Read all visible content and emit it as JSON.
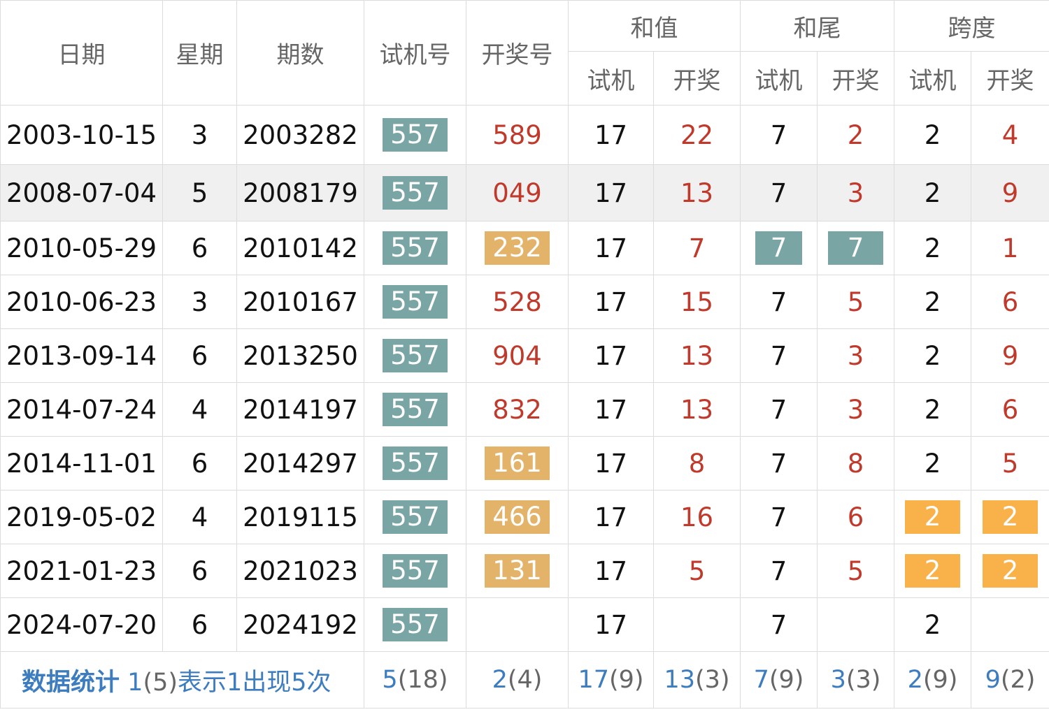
{
  "headers": {
    "date": "日期",
    "weekday": "星期",
    "issue": "期数",
    "trial": "试机号",
    "draw": "开奖号",
    "sum": "和值",
    "tail": "和尾",
    "span": "跨度",
    "sub_trial": "试机",
    "sub_draw": "开奖"
  },
  "rows": [
    {
      "date": "2003-10-15",
      "weekday": "3",
      "issue": "2003282",
      "trial": "557",
      "draw": "589",
      "draw_hl": false,
      "sum_trial": "17",
      "sum_draw": "22",
      "tail_trial": "7",
      "tail_draw": "2",
      "tail_hl": false,
      "span_trial": "2",
      "span_draw": "4",
      "span_hl": false
    },
    {
      "date": "2008-07-04",
      "weekday": "5",
      "issue": "2008179",
      "trial": "557",
      "draw": "049",
      "draw_hl": false,
      "sum_trial": "17",
      "sum_draw": "13",
      "tail_trial": "7",
      "tail_draw": "3",
      "tail_hl": false,
      "span_trial": "2",
      "span_draw": "9",
      "span_hl": false
    },
    {
      "date": "2010-05-29",
      "weekday": "6",
      "issue": "2010142",
      "trial": "557",
      "draw": "232",
      "draw_hl": true,
      "sum_trial": "17",
      "sum_draw": "7",
      "tail_trial": "7",
      "tail_draw": "7",
      "tail_hl": true,
      "span_trial": "2",
      "span_draw": "1",
      "span_hl": false
    },
    {
      "date": "2010-06-23",
      "weekday": "3",
      "issue": "2010167",
      "trial": "557",
      "draw": "528",
      "draw_hl": false,
      "sum_trial": "17",
      "sum_draw": "15",
      "tail_trial": "7",
      "tail_draw": "5",
      "tail_hl": false,
      "span_trial": "2",
      "span_draw": "6",
      "span_hl": false
    },
    {
      "date": "2013-09-14",
      "weekday": "6",
      "issue": "2013250",
      "trial": "557",
      "draw": "904",
      "draw_hl": false,
      "sum_trial": "17",
      "sum_draw": "13",
      "tail_trial": "7",
      "tail_draw": "3",
      "tail_hl": false,
      "span_trial": "2",
      "span_draw": "9",
      "span_hl": false
    },
    {
      "date": "2014-07-24",
      "weekday": "4",
      "issue": "2014197",
      "trial": "557",
      "draw": "832",
      "draw_hl": false,
      "sum_trial": "17",
      "sum_draw": "13",
      "tail_trial": "7",
      "tail_draw": "3",
      "tail_hl": false,
      "span_trial": "2",
      "span_draw": "6",
      "span_hl": false
    },
    {
      "date": "2014-11-01",
      "weekday": "6",
      "issue": "2014297",
      "trial": "557",
      "draw": "161",
      "draw_hl": true,
      "sum_trial": "17",
      "sum_draw": "8",
      "tail_trial": "7",
      "tail_draw": "8",
      "tail_hl": false,
      "span_trial": "2",
      "span_draw": "5",
      "span_hl": false
    },
    {
      "date": "2019-05-02",
      "weekday": "4",
      "issue": "2019115",
      "trial": "557",
      "draw": "466",
      "draw_hl": true,
      "sum_trial": "17",
      "sum_draw": "16",
      "tail_trial": "7",
      "tail_draw": "6",
      "tail_hl": false,
      "span_trial": "2",
      "span_draw": "2",
      "span_hl": true
    },
    {
      "date": "2021-01-23",
      "weekday": "6",
      "issue": "2021023",
      "trial": "557",
      "draw": "131",
      "draw_hl": true,
      "sum_trial": "17",
      "sum_draw": "5",
      "tail_trial": "7",
      "tail_draw": "5",
      "tail_hl": false,
      "span_trial": "2",
      "span_draw": "2",
      "span_hl": true
    },
    {
      "date": "2024-07-20",
      "weekday": "6",
      "issue": "2024192",
      "trial": "557",
      "draw": "",
      "draw_hl": false,
      "sum_trial": "17",
      "sum_draw": "",
      "tail_trial": "7",
      "tail_draw": "",
      "tail_hl": false,
      "span_trial": "2",
      "span_draw": "",
      "span_hl": false
    }
  ],
  "summary": {
    "title": "数据统计",
    "note_a": "1",
    "note_b": "(5)",
    "note_c": "表示1出现5次",
    "cells": [
      {
        "a": "5",
        "b": "(18)"
      },
      {
        "a": "2",
        "b": "(4)"
      },
      {
        "a": "17",
        "b": "(9)"
      },
      {
        "a": "13",
        "b": "(3)"
      },
      {
        "a": "7",
        "b": "(9)"
      },
      {
        "a": "3",
        "b": "(3)"
      },
      {
        "a": "2",
        "b": "(9)"
      },
      {
        "a": "9",
        "b": "(2)"
      }
    ]
  },
  "colors": {
    "trial_box": "#7aa5a5",
    "draw_box": "#e3b36a",
    "span_box": "#f9b24a",
    "draw_text": "#c0392b",
    "summary_text": "#3d7dbf"
  }
}
